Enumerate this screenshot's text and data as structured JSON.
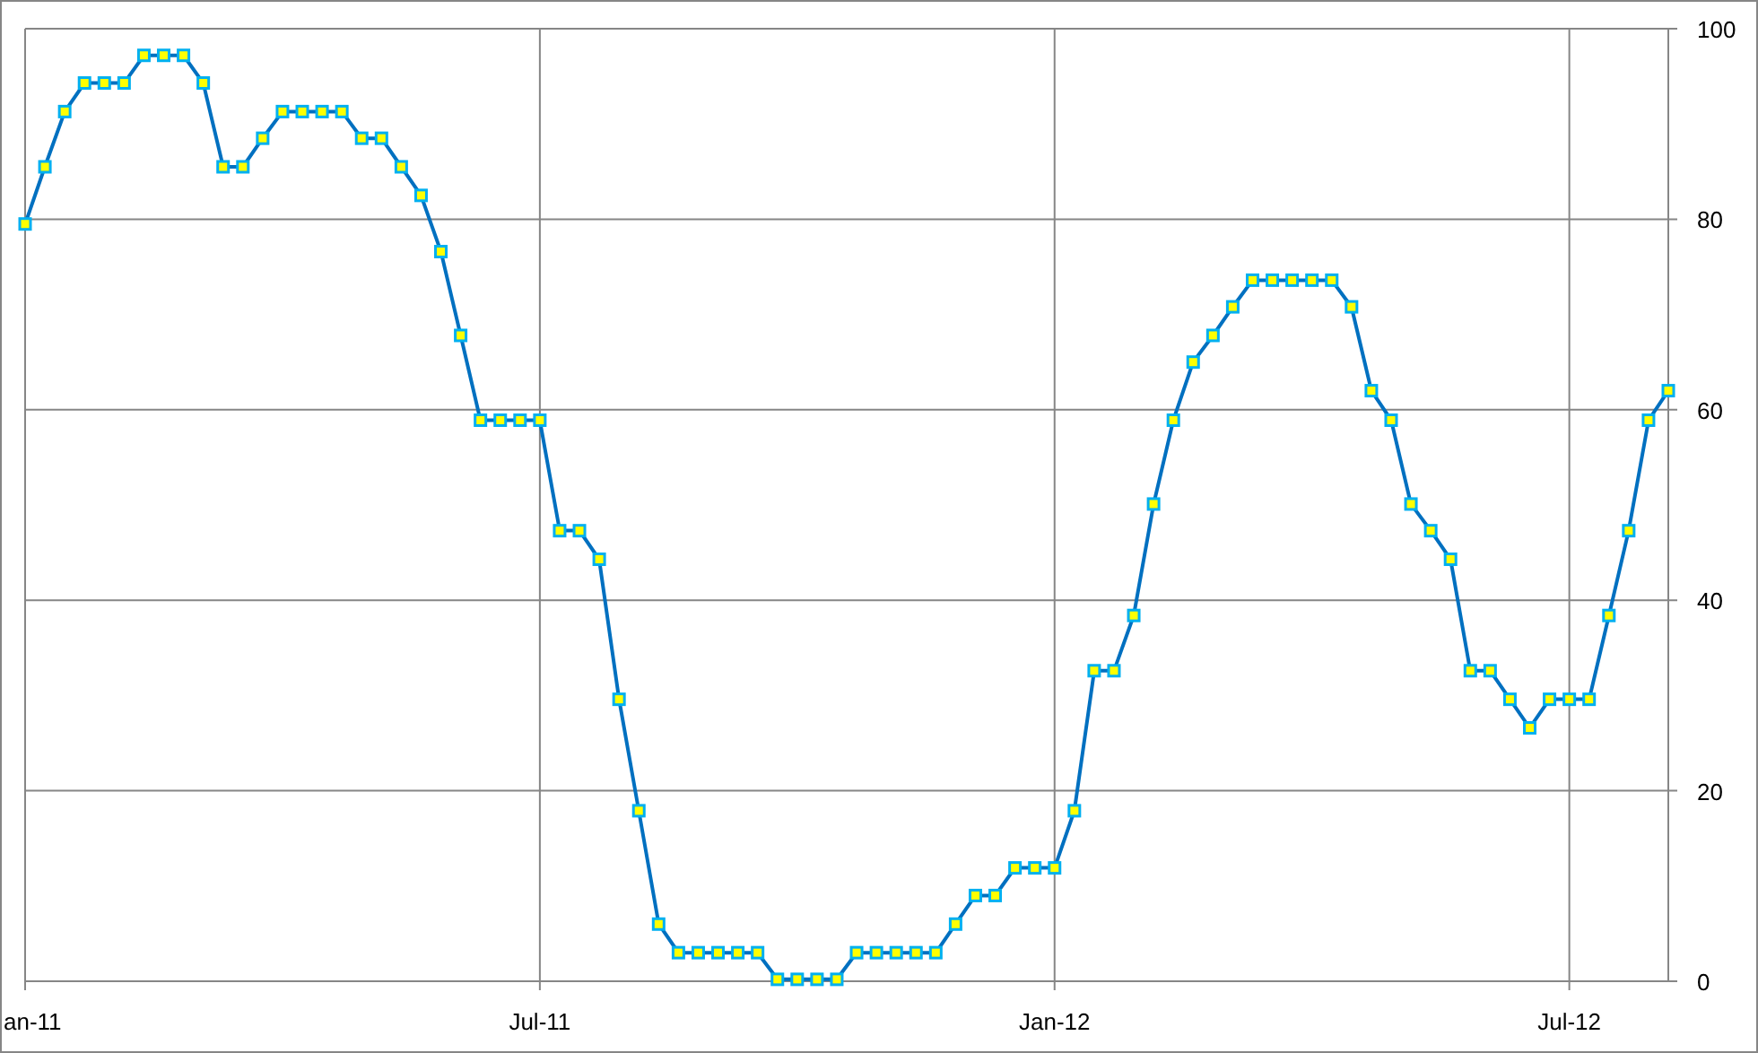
{
  "chart": {
    "chart_data": {
      "type": "line",
      "categories": [
        "an-11",
        null,
        null,
        null,
        null,
        null,
        null,
        null,
        null,
        null,
        null,
        null,
        null,
        null,
        null,
        null,
        null,
        null,
        null,
        null,
        null,
        null,
        null,
        null,
        null,
        null,
        "Jul-11",
        null,
        null,
        null,
        null,
        null,
        null,
        null,
        null,
        null,
        null,
        null,
        null,
        null,
        null,
        null,
        null,
        null,
        null,
        null,
        null,
        null,
        null,
        null,
        null,
        null,
        "Jan-12",
        null,
        null,
        null,
        null,
        null,
        null,
        null,
        null,
        null,
        null,
        null,
        null,
        null,
        null,
        null,
        null,
        null,
        null,
        null,
        null,
        null,
        null,
        null,
        null,
        null,
        "Jul-12",
        null,
        null,
        null,
        null,
        null
      ],
      "series": [
        {
          "marker": "square",
          "color": "#0070c0",
          "values": [
            79.5,
            85.5,
            91.3,
            94.3,
            94.3,
            94.3,
            97.2,
            97.2,
            97.2,
            94.3,
            85.5,
            85.5,
            88.5,
            91.3,
            91.3,
            91.3,
            91.3,
            88.5,
            88.5,
            85.5,
            82.5,
            76.6,
            67.8,
            58.9,
            58.9,
            58.9,
            58.9,
            47.3,
            47.3,
            44.3,
            29.6,
            17.9,
            6,
            3,
            3,
            3,
            3,
            3,
            0.2,
            0.2,
            0.2,
            0.2,
            3,
            3,
            3,
            3,
            3,
            6,
            9,
            9,
            11.9,
            11.9,
            11.9,
            17.9,
            32.6,
            32.6,
            38.4,
            50.1,
            58.9,
            65,
            67.8,
            70.8,
            73.6,
            73.6,
            73.6,
            73.6,
            73.6,
            70.8,
            62,
            58.9,
            50.1,
            47.3,
            44.3,
            32.6,
            32.6,
            29.6,
            26.6,
            29.6,
            29.6,
            29.6,
            38.4,
            47.3,
            58.9,
            62
          ]
        }
      ],
      "ylim": [
        0,
        100
      ],
      "grid": true,
      "yticks": [
        0,
        20,
        40,
        60,
        80,
        100
      ]
    }
  }
}
